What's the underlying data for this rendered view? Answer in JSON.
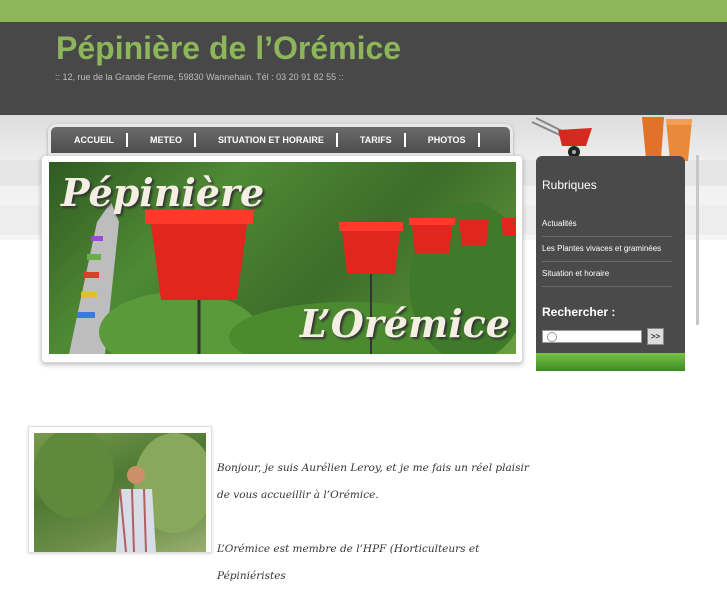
{
  "site": {
    "title": "Pépinière de l’Orémice",
    "address": ":: 12, rue de la Grande Ferme, 59830 Wannehain. Tél : 03 20 91 82 55 ::"
  },
  "nav": {
    "items": [
      {
        "label": "ACCUEIL"
      },
      {
        "label": "METEO"
      },
      {
        "label": "SITUATION ET HORAIRE"
      },
      {
        "label": "TARIFS"
      },
      {
        "label": "PHOTOS"
      }
    ]
  },
  "banner": {
    "line1": "Pépinière",
    "line2": "L’Orémice"
  },
  "sidebar": {
    "heading": "Rubriques",
    "links": [
      {
        "label": "Actualités"
      },
      {
        "label": "Les Plantes vivaces et graminées"
      },
      {
        "label": "Situation et horaire"
      }
    ],
    "search_heading": "Rechercher :",
    "search_button": ">>"
  },
  "content": {
    "paragraph1": "Bonjour, je suis Aurélien Leroy, et je me fais un réel plaisir de vous accueillir à l’Orémice.",
    "paragraph2": "L’Orémice est membre de l’HPF (Horticulteurs et Pépiniéristes"
  },
  "colors": {
    "accent": "#8db55a",
    "header_bg": "#484848",
    "sidebar_bg": "#4a4a4a",
    "pot_red": "#e0261e"
  }
}
